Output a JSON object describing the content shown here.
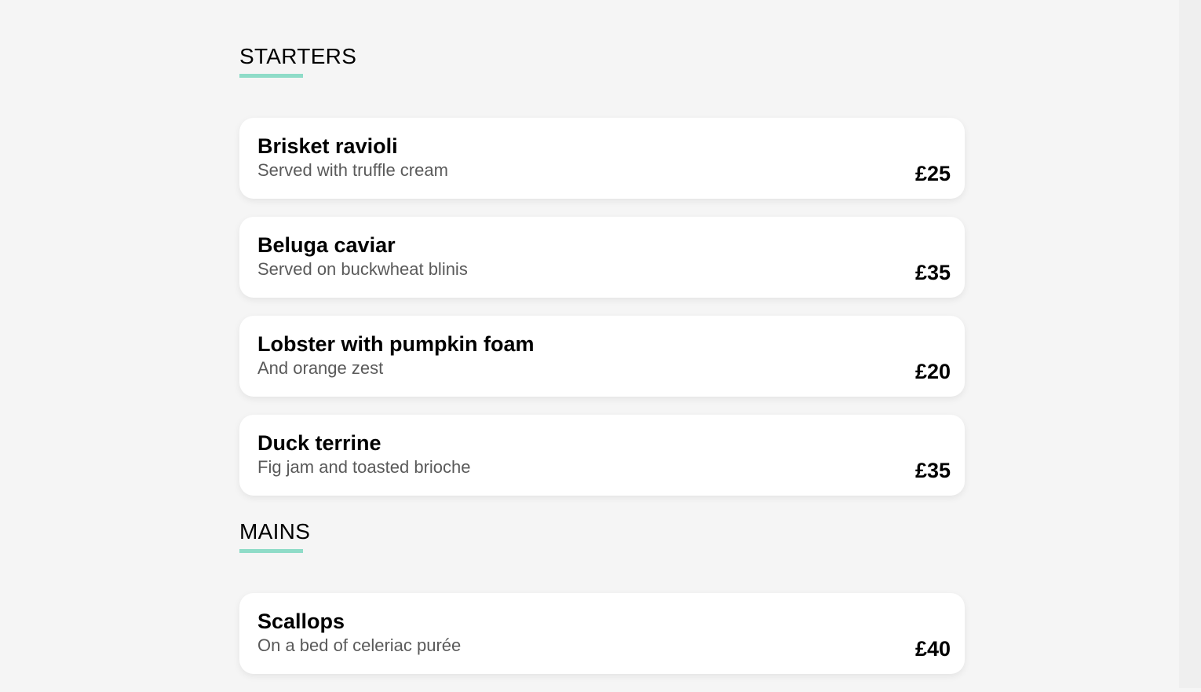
{
  "sections": [
    {
      "title": "STARTERS",
      "items": [
        {
          "name": "Brisket ravioli",
          "description": "Served with truffle cream",
          "price": "£25"
        },
        {
          "name": "Beluga caviar",
          "description": "Served on buckwheat blinis",
          "price": "£35"
        },
        {
          "name": "Lobster with pumpkin foam",
          "description": "And orange zest",
          "price": "£20"
        },
        {
          "name": "Duck terrine",
          "description": "Fig jam and toasted brioche",
          "price": "£35"
        }
      ]
    },
    {
      "title": "MAINS",
      "items": [
        {
          "name": "Scallops",
          "description": "On a bed of celeriac purée",
          "price": "£40"
        }
      ]
    }
  ],
  "colors": {
    "background": "#f5f5f5",
    "accent": "#8fdcc8",
    "card": "#ffffff"
  }
}
